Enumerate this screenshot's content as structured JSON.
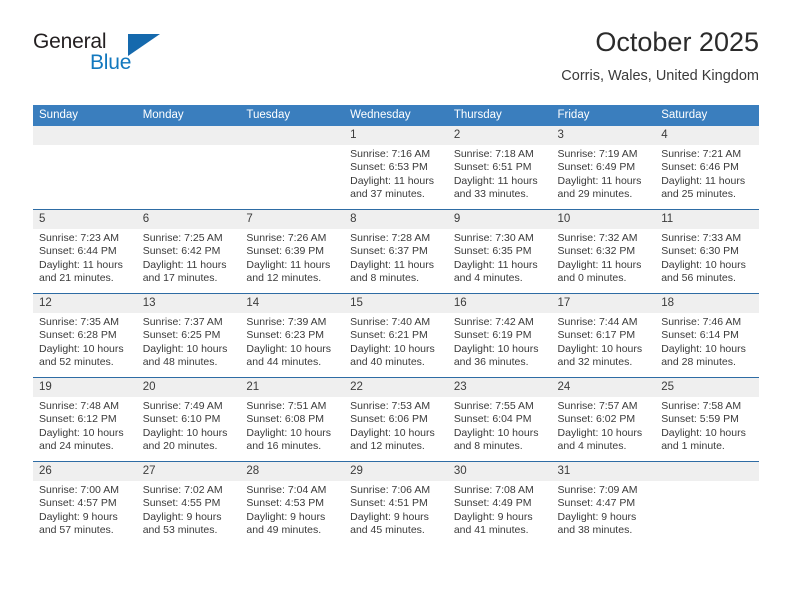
{
  "brand": {
    "name_part1": "General",
    "name_part2": "Blue",
    "logo_icon": "triangle-logo-icon",
    "accent_color": "#1569ad"
  },
  "header": {
    "title": "October 2025",
    "subtitle": "Corris, Wales, United Kingdom"
  },
  "theme": {
    "header_row_color": "#3a7ebe",
    "row_divider_color": "#2e6ca4",
    "daynum_band_color": "#efefef"
  },
  "weekday_headers": [
    "Sunday",
    "Monday",
    "Tuesday",
    "Wednesday",
    "Thursday",
    "Friday",
    "Saturday"
  ],
  "weeks": [
    [
      {
        "day": "",
        "empty": true
      },
      {
        "day": "",
        "empty": true
      },
      {
        "day": "",
        "empty": true
      },
      {
        "day": "1",
        "sunrise": "Sunrise: 7:16 AM",
        "sunset": "Sunset: 6:53 PM",
        "daylight1": "Daylight: 11 hours",
        "daylight2": "and 37 minutes."
      },
      {
        "day": "2",
        "sunrise": "Sunrise: 7:18 AM",
        "sunset": "Sunset: 6:51 PM",
        "daylight1": "Daylight: 11 hours",
        "daylight2": "and 33 minutes."
      },
      {
        "day": "3",
        "sunrise": "Sunrise: 7:19 AM",
        "sunset": "Sunset: 6:49 PM",
        "daylight1": "Daylight: 11 hours",
        "daylight2": "and 29 minutes."
      },
      {
        "day": "4",
        "sunrise": "Sunrise: 7:21 AM",
        "sunset": "Sunset: 6:46 PM",
        "daylight1": "Daylight: 11 hours",
        "daylight2": "and 25 minutes."
      }
    ],
    [
      {
        "day": "5",
        "sunrise": "Sunrise: 7:23 AM",
        "sunset": "Sunset: 6:44 PM",
        "daylight1": "Daylight: 11 hours",
        "daylight2": "and 21 minutes."
      },
      {
        "day": "6",
        "sunrise": "Sunrise: 7:25 AM",
        "sunset": "Sunset: 6:42 PM",
        "daylight1": "Daylight: 11 hours",
        "daylight2": "and 17 minutes."
      },
      {
        "day": "7",
        "sunrise": "Sunrise: 7:26 AM",
        "sunset": "Sunset: 6:39 PM",
        "daylight1": "Daylight: 11 hours",
        "daylight2": "and 12 minutes."
      },
      {
        "day": "8",
        "sunrise": "Sunrise: 7:28 AM",
        "sunset": "Sunset: 6:37 PM",
        "daylight1": "Daylight: 11 hours",
        "daylight2": "and 8 minutes."
      },
      {
        "day": "9",
        "sunrise": "Sunrise: 7:30 AM",
        "sunset": "Sunset: 6:35 PM",
        "daylight1": "Daylight: 11 hours",
        "daylight2": "and 4 minutes."
      },
      {
        "day": "10",
        "sunrise": "Sunrise: 7:32 AM",
        "sunset": "Sunset: 6:32 PM",
        "daylight1": "Daylight: 11 hours",
        "daylight2": "and 0 minutes."
      },
      {
        "day": "11",
        "sunrise": "Sunrise: 7:33 AM",
        "sunset": "Sunset: 6:30 PM",
        "daylight1": "Daylight: 10 hours",
        "daylight2": "and 56 minutes."
      }
    ],
    [
      {
        "day": "12",
        "sunrise": "Sunrise: 7:35 AM",
        "sunset": "Sunset: 6:28 PM",
        "daylight1": "Daylight: 10 hours",
        "daylight2": "and 52 minutes."
      },
      {
        "day": "13",
        "sunrise": "Sunrise: 7:37 AM",
        "sunset": "Sunset: 6:25 PM",
        "daylight1": "Daylight: 10 hours",
        "daylight2": "and 48 minutes."
      },
      {
        "day": "14",
        "sunrise": "Sunrise: 7:39 AM",
        "sunset": "Sunset: 6:23 PM",
        "daylight1": "Daylight: 10 hours",
        "daylight2": "and 44 minutes."
      },
      {
        "day": "15",
        "sunrise": "Sunrise: 7:40 AM",
        "sunset": "Sunset: 6:21 PM",
        "daylight1": "Daylight: 10 hours",
        "daylight2": "and 40 minutes."
      },
      {
        "day": "16",
        "sunrise": "Sunrise: 7:42 AM",
        "sunset": "Sunset: 6:19 PM",
        "daylight1": "Daylight: 10 hours",
        "daylight2": "and 36 minutes."
      },
      {
        "day": "17",
        "sunrise": "Sunrise: 7:44 AM",
        "sunset": "Sunset: 6:17 PM",
        "daylight1": "Daylight: 10 hours",
        "daylight2": "and 32 minutes."
      },
      {
        "day": "18",
        "sunrise": "Sunrise: 7:46 AM",
        "sunset": "Sunset: 6:14 PM",
        "daylight1": "Daylight: 10 hours",
        "daylight2": "and 28 minutes."
      }
    ],
    [
      {
        "day": "19",
        "sunrise": "Sunrise: 7:48 AM",
        "sunset": "Sunset: 6:12 PM",
        "daylight1": "Daylight: 10 hours",
        "daylight2": "and 24 minutes."
      },
      {
        "day": "20",
        "sunrise": "Sunrise: 7:49 AM",
        "sunset": "Sunset: 6:10 PM",
        "daylight1": "Daylight: 10 hours",
        "daylight2": "and 20 minutes."
      },
      {
        "day": "21",
        "sunrise": "Sunrise: 7:51 AM",
        "sunset": "Sunset: 6:08 PM",
        "daylight1": "Daylight: 10 hours",
        "daylight2": "and 16 minutes."
      },
      {
        "day": "22",
        "sunrise": "Sunrise: 7:53 AM",
        "sunset": "Sunset: 6:06 PM",
        "daylight1": "Daylight: 10 hours",
        "daylight2": "and 12 minutes."
      },
      {
        "day": "23",
        "sunrise": "Sunrise: 7:55 AM",
        "sunset": "Sunset: 6:04 PM",
        "daylight1": "Daylight: 10 hours",
        "daylight2": "and 8 minutes."
      },
      {
        "day": "24",
        "sunrise": "Sunrise: 7:57 AM",
        "sunset": "Sunset: 6:02 PM",
        "daylight1": "Daylight: 10 hours",
        "daylight2": "and 4 minutes."
      },
      {
        "day": "25",
        "sunrise": "Sunrise: 7:58 AM",
        "sunset": "Sunset: 5:59 PM",
        "daylight1": "Daylight: 10 hours",
        "daylight2": "and 1 minute."
      }
    ],
    [
      {
        "day": "26",
        "sunrise": "Sunrise: 7:00 AM",
        "sunset": "Sunset: 4:57 PM",
        "daylight1": "Daylight: 9 hours",
        "daylight2": "and 57 minutes."
      },
      {
        "day": "27",
        "sunrise": "Sunrise: 7:02 AM",
        "sunset": "Sunset: 4:55 PM",
        "daylight1": "Daylight: 9 hours",
        "daylight2": "and 53 minutes."
      },
      {
        "day": "28",
        "sunrise": "Sunrise: 7:04 AM",
        "sunset": "Sunset: 4:53 PM",
        "daylight1": "Daylight: 9 hours",
        "daylight2": "and 49 minutes."
      },
      {
        "day": "29",
        "sunrise": "Sunrise: 7:06 AM",
        "sunset": "Sunset: 4:51 PM",
        "daylight1": "Daylight: 9 hours",
        "daylight2": "and 45 minutes."
      },
      {
        "day": "30",
        "sunrise": "Sunrise: 7:08 AM",
        "sunset": "Sunset: 4:49 PM",
        "daylight1": "Daylight: 9 hours",
        "daylight2": "and 41 minutes."
      },
      {
        "day": "31",
        "sunrise": "Sunrise: 7:09 AM",
        "sunset": "Sunset: 4:47 PM",
        "daylight1": "Daylight: 9 hours",
        "daylight2": "and 38 minutes."
      },
      {
        "day": "",
        "empty": true
      }
    ]
  ]
}
